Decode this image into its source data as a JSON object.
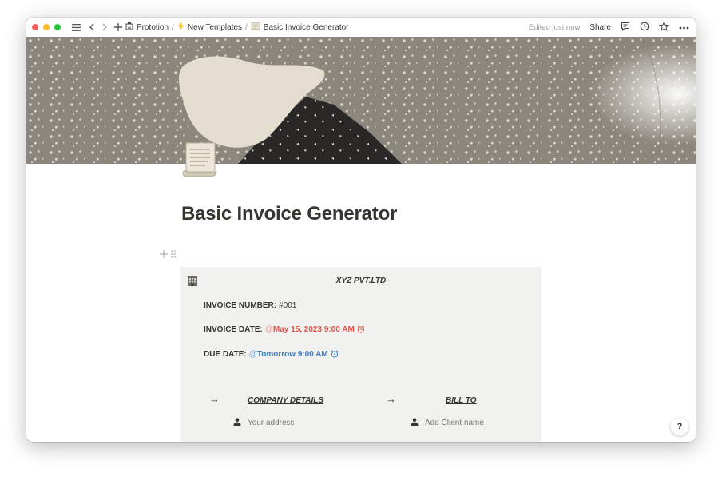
{
  "window": {
    "traffic_lights": {
      "close": "#ff5f57",
      "minimize": "#febc2e",
      "zoom": "#28c840"
    }
  },
  "topbar": {
    "breadcrumbs": [
      {
        "label": "Prototion",
        "icon": "workspace-icon"
      },
      {
        "label": "New Templates",
        "icon": "lightning-icon"
      },
      {
        "label": "Basic Invoice Generator",
        "icon": "scroll-icon"
      }
    ],
    "separator": "/",
    "edited_status": "Edited just now",
    "share_label": "Share",
    "icons": [
      "menu-icon",
      "back-icon",
      "forward-icon",
      "add-icon",
      "comment-icon",
      "history-icon",
      "favorite-icon",
      "more-icon"
    ]
  },
  "page": {
    "icon": "scroll-icon",
    "title": "Basic Invoice Generator"
  },
  "invoice": {
    "company_icon": "office-building-icon",
    "company_name": "XYZ PVT.LTD",
    "invoice_number_label": "INVOICE NUMBER:",
    "invoice_number_value": "#001",
    "invoice_date_label": "INVOICE DATE:",
    "invoice_date_value": "May 15, 2023 9:00 AM",
    "due_date_label": "DUE DATE:",
    "due_date_value": "Tomorrow 9:00 AM",
    "mention_prefix": "@",
    "company_details_title": "COMPANY DETAILS",
    "bill_to_title": "BILL TO",
    "address_placeholder": "Your address",
    "client_placeholder": "Add Client name",
    "accent_red": "#e0554b",
    "accent_blue": "#3e7fc1"
  },
  "help_label": "?"
}
